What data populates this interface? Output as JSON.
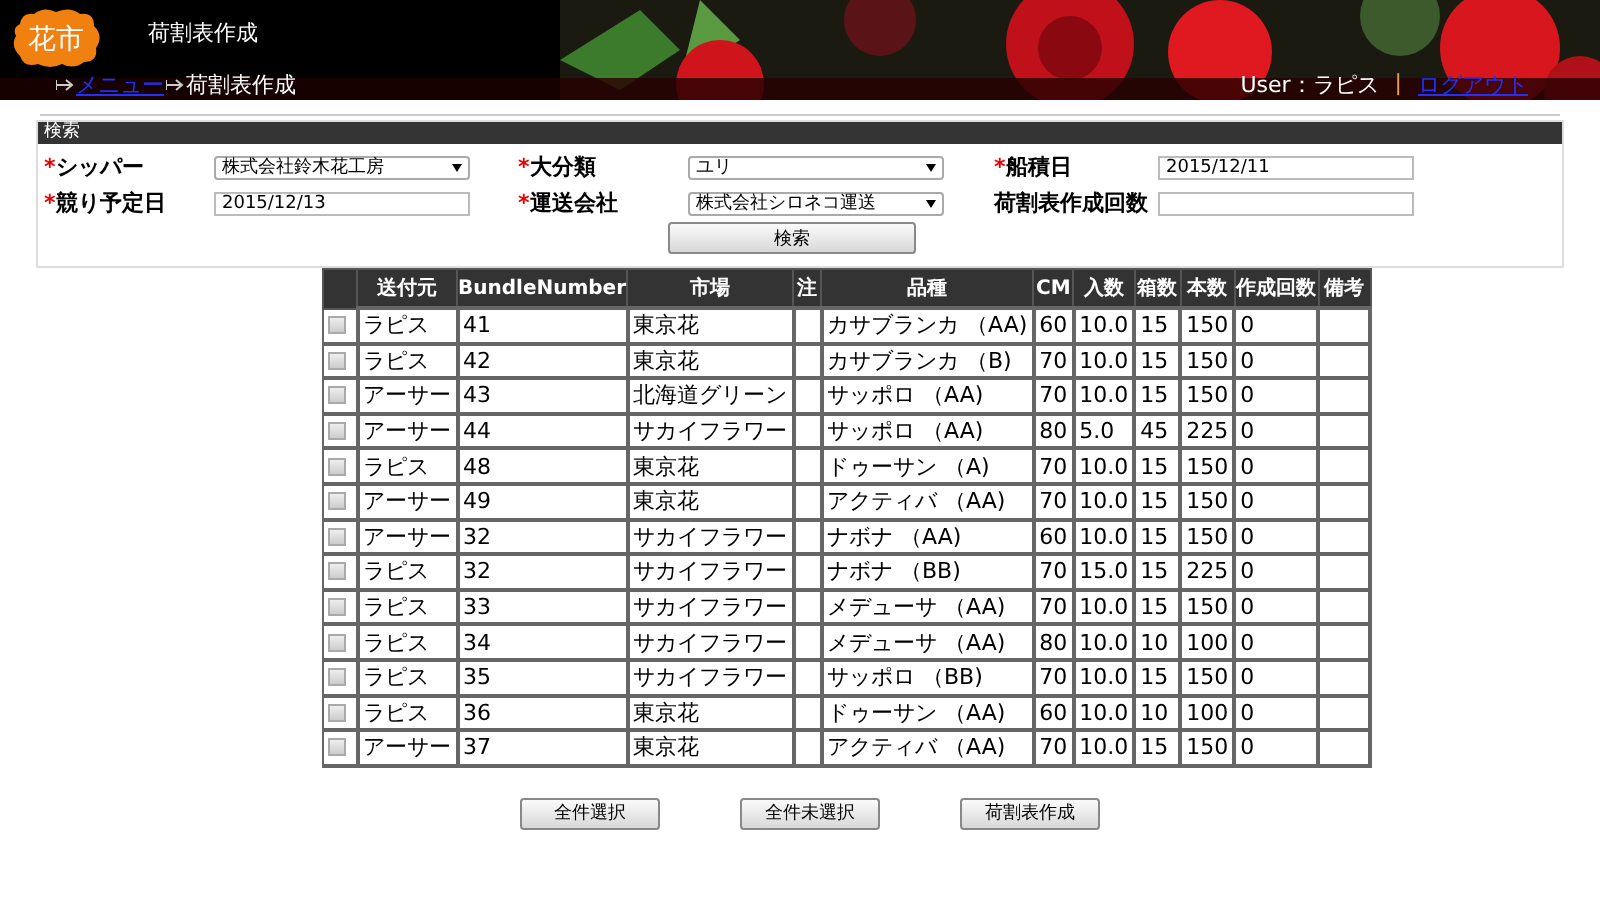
{
  "header": {
    "logo": "花市",
    "title": "荷割表作成",
    "breadcrumb": [
      {
        "label": "メニュー",
        "link": true
      },
      {
        "label": "荷割表作成",
        "link": false
      }
    ],
    "user_label": "User：ラピス",
    "separator": "|",
    "logout": "ログアウト"
  },
  "search": {
    "title": "検索",
    "fields": [
      {
        "mark": "*",
        "label": "シッパー",
        "kind": "select",
        "value": "株式会社鈴木花工房"
      },
      {
        "mark": "*",
        "label": "大分類",
        "kind": "select",
        "value": "ユリ"
      },
      {
        "mark": "*",
        "label": "船積日",
        "kind": "text",
        "value": "2015/12/11"
      },
      {
        "mark": "*",
        "label": "競り予定日",
        "kind": "text",
        "value": "2015/12/13"
      },
      {
        "mark": "*",
        "label": "運送会社",
        "kind": "select",
        "value": "株式会社シロネコ運送"
      },
      {
        "label": "荷割表作成回数",
        "kind": "text"
      }
    ],
    "button": "検索"
  },
  "table": {
    "columns": [
      "送付元",
      "BundleNumber",
      "市場",
      "注",
      "品種",
      "CM",
      "入数",
      "箱数",
      "本数",
      "作成回数",
      "備考"
    ],
    "rows": [
      {
        "checked": false,
        "cells": [
          "ラピス",
          "41",
          "東京花",
          "",
          "カサブランカ （AA)",
          "60",
          "10.0",
          "15",
          "150",
          "0",
          ""
        ]
      },
      {
        "checked": false,
        "cells": [
          "ラピス",
          "42",
          "東京花",
          "",
          "カサブランカ （B)",
          "70",
          "10.0",
          "15",
          "150",
          "0",
          ""
        ]
      },
      {
        "checked": false,
        "cells": [
          "アーサー",
          "43",
          "北海道グリーン",
          "",
          "サッポロ （AA)",
          "70",
          "10.0",
          "15",
          "150",
          "0",
          ""
        ]
      },
      {
        "checked": false,
        "cells": [
          "アーサー",
          "44",
          "サカイフラワー",
          "",
          "サッポロ （AA)",
          "80",
          "5.0",
          "45",
          "225",
          "0",
          ""
        ]
      },
      {
        "checked": false,
        "cells": [
          "ラピス",
          "48",
          "東京花",
          "",
          "ドゥーサン （A)",
          "70",
          "10.0",
          "15",
          "150",
          "0",
          ""
        ]
      },
      {
        "checked": false,
        "cells": [
          "アーサー",
          "49",
          "東京花",
          "",
          "アクティバ （AA)",
          "70",
          "10.0",
          "15",
          "150",
          "0",
          ""
        ]
      },
      {
        "checked": false,
        "cells": [
          "アーサー",
          "32",
          "サカイフラワー",
          "",
          "ナボナ （AA)",
          "60",
          "10.0",
          "15",
          "150",
          "0",
          ""
        ]
      },
      {
        "checked": false,
        "cells": [
          "ラピス",
          "32",
          "サカイフラワー",
          "",
          "ナボナ （BB)",
          "70",
          "15.0",
          "15",
          "225",
          "0",
          ""
        ]
      },
      {
        "checked": false,
        "cells": [
          "ラピス",
          "33",
          "サカイフラワー",
          "",
          "メデューサ （AA)",
          "70",
          "10.0",
          "15",
          "150",
          "0",
          ""
        ]
      },
      {
        "checked": false,
        "cells": [
          "ラピス",
          "34",
          "サカイフラワー",
          "",
          "メデューサ （AA)",
          "80",
          "10.0",
          "10",
          "100",
          "0",
          ""
        ]
      },
      {
        "checked": false,
        "cells": [
          "ラピス",
          "35",
          "サカイフラワー",
          "",
          "サッポロ （BB)",
          "70",
          "10.0",
          "15",
          "150",
          "0",
          ""
        ]
      },
      {
        "checked": false,
        "cells": [
          "ラピス",
          "36",
          "東京花",
          "",
          "ドゥーサン （AA)",
          "60",
          "10.0",
          "10",
          "100",
          "0",
          ""
        ]
      },
      {
        "checked": false,
        "cells": [
          "アーサー",
          "37",
          "東京花",
          "",
          "アクティバ （AA)",
          "70",
          "10.0",
          "15",
          "150",
          "0",
          ""
        ]
      }
    ]
  },
  "buttons": [
    "全件選択",
    "全件未選択",
    "荷割表作成"
  ]
}
